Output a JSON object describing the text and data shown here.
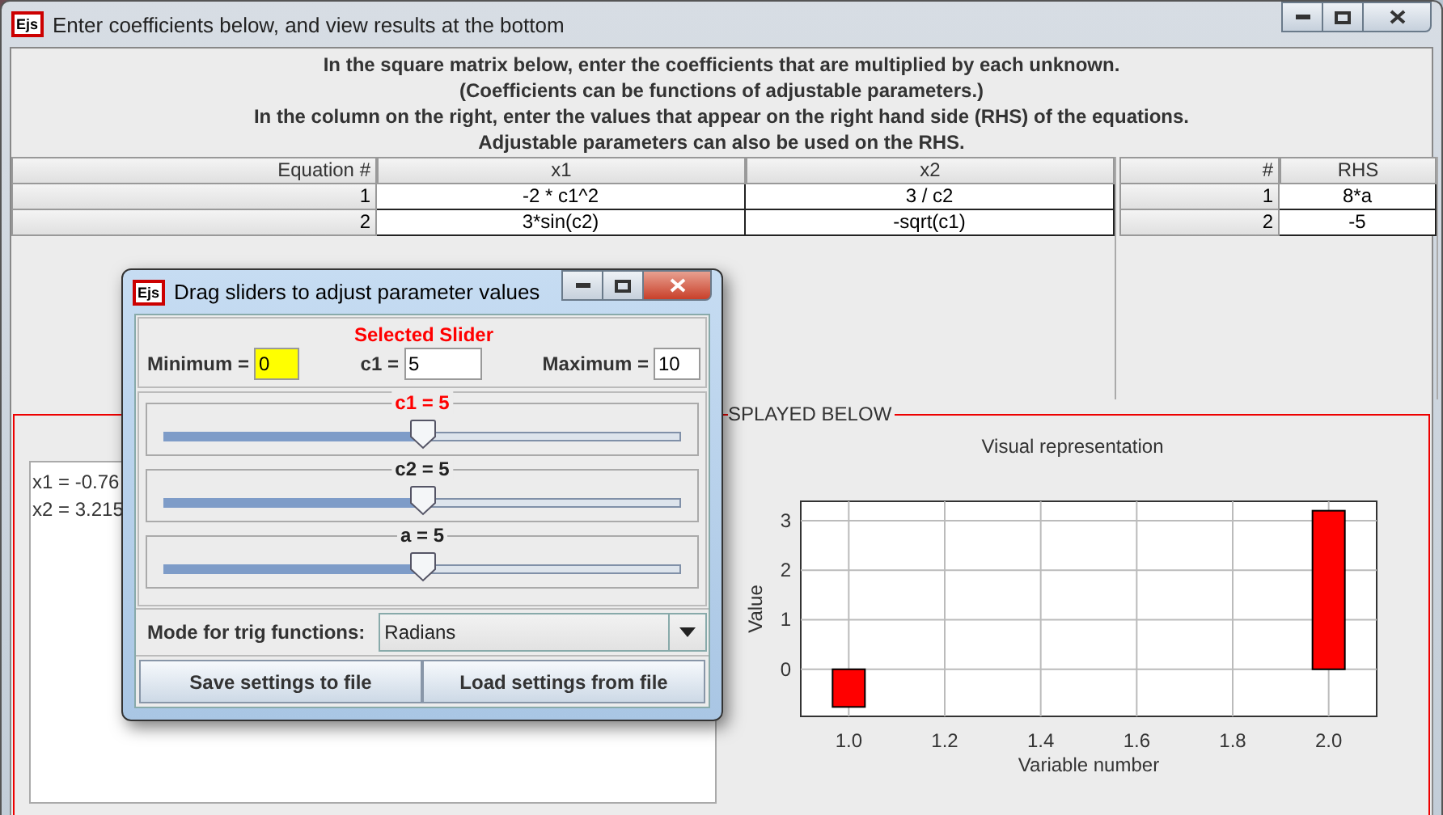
{
  "window": {
    "logo": "Ejs",
    "title": "Enter coefficients below, and view results at the bottom",
    "active": false
  },
  "instructions": [
    "In the square matrix below, enter the coefficients that are multiplied by each unknown.",
    "(Coefficients can be functions of adjustable parameters.)",
    "In the column on the right, enter the values that appear on the right hand side (RHS) of the equations.",
    "Adjustable parameters can also be used on the RHS."
  ],
  "matrix": {
    "columns": [
      "Equation #",
      "x1",
      "x2"
    ],
    "rows": [
      [
        "1",
        "-2 * c1^2",
        "3 / c2"
      ],
      [
        "2",
        "3*sin(c2)",
        "-sqrt(c1)"
      ]
    ]
  },
  "rhs": {
    "columns": [
      "#",
      "RHS"
    ],
    "rows": [
      [
        "1",
        "8*a"
      ],
      [
        "2",
        "-5"
      ]
    ]
  },
  "results": {
    "legend": "SPLAYED BELOW",
    "lines": [
      "x1 = -0.76",
      "x2 = 3.215"
    ],
    "chart_data": {
      "type": "bar",
      "title": "Visual representation",
      "xlabel": "Variable number",
      "ylabel": "Value",
      "x": [
        1.0,
        2.0
      ],
      "series": [
        {
          "color": "#ff0000",
          "values": [
            -0.76,
            3.2
          ]
        }
      ],
      "grid": true,
      "xlim": [
        0.9,
        2.1
      ],
      "ylim": [
        -0.95,
        3.39
      ],
      "xticks": [
        {
          "value": 1.0,
          "label": "1.0"
        },
        {
          "value": 1.2,
          "label": "1.2"
        },
        {
          "value": 1.4,
          "label": "1.4"
        },
        {
          "value": 1.6,
          "label": "1.6"
        },
        {
          "value": 1.8,
          "label": "1.8"
        },
        {
          "value": 2.0,
          "label": "2.0"
        }
      ],
      "yticks": [
        0,
        1,
        2,
        3
      ]
    }
  },
  "dialog": {
    "logo": "Ejs",
    "title": "Drag sliders to adjust parameter values",
    "active": true,
    "selected": {
      "heading": "Selected Slider",
      "minimum_label": "Minimum =",
      "minimum": "0",
      "minimum_highlighted": true,
      "value_label": "c1 =",
      "value": "5",
      "maximum_label": "Maximum =",
      "maximum": "10"
    },
    "sliders": [
      {
        "label": "c1 = 5",
        "level": 0.5,
        "selected": true
      },
      {
        "label": "c2 = 5",
        "level": 0.5,
        "selected": false
      },
      {
        "label": "a = 5",
        "level": 0.5,
        "selected": false
      }
    ],
    "mode": {
      "label": "Mode for trig functions:",
      "value": "Radians"
    },
    "buttons": [
      "Save settings to file",
      "Load settings from file"
    ]
  }
}
